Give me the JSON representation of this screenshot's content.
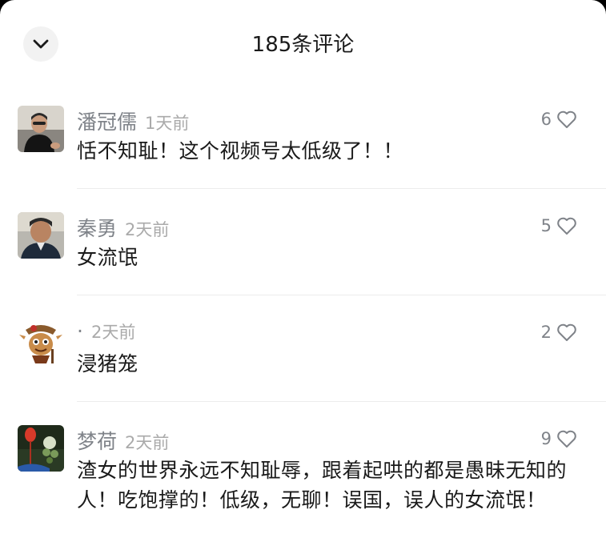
{
  "header": {
    "title": "185条评论",
    "collapse_icon": "chevron-down-icon"
  },
  "comments": [
    {
      "name": "潘冠儒",
      "time": "1天前",
      "text": "恬不知耻！这个视频号太低级了！！",
      "likes": "6"
    },
    {
      "name": "秦勇",
      "time": "2天前",
      "text": "女流氓",
      "likes": "5"
    },
    {
      "name": "·",
      "time": "2天前",
      "text": "浸猪笼",
      "likes": "2"
    },
    {
      "name": "梦荷",
      "time": "2天前",
      "text": "渣女的世界永远不知耻辱，跟着起哄的都是愚昧无知的人！吃饱撑的！低级，无聊！误国，误人的女流氓！",
      "likes": "9"
    }
  ],
  "colors": {
    "background": "#ffffff",
    "text_primary": "#1a1a1a",
    "text_secondary": "#7f8389",
    "divider": "#ececec"
  }
}
